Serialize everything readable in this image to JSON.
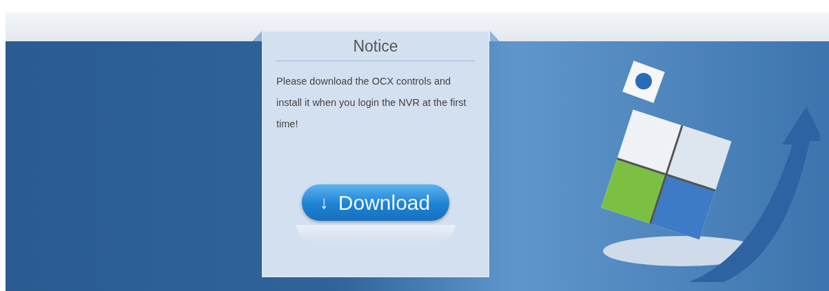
{
  "notice": {
    "title": "Notice",
    "message": "Please download the OCX controls and install it when you login the NVR at the first time!",
    "button": {
      "label": "Download",
      "icon": "↓"
    }
  }
}
